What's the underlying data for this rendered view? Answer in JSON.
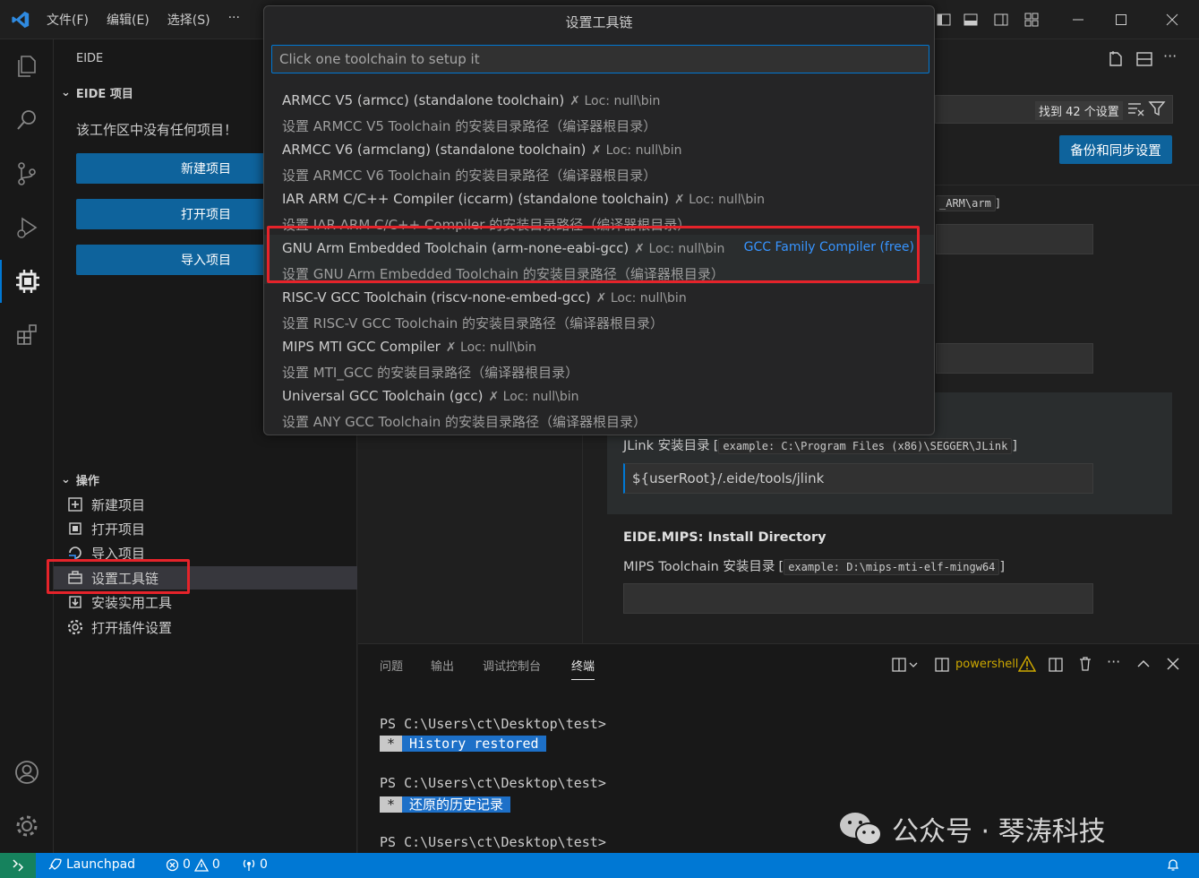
{
  "menu": {
    "file": "文件(F)",
    "edit": "编辑(E)",
    "select": "选择(S)",
    "more": "···"
  },
  "quick_pick": {
    "title": "设置工具链",
    "placeholder": "Click one toolchain to setup it",
    "items": [
      {
        "label": "ARMCC V5 (armcc) (standalone toolchain)",
        "loc": "✗ Loc: null\\bin",
        "detail": "设置 ARMCC V5 Toolchain 的安装目录路径（编译器根目录）",
        "desc": ""
      },
      {
        "label": "ARMCC V6 (armclang) (standalone toolchain)",
        "loc": "✗ Loc: null\\bin",
        "detail": "设置 ARMCC V6 Toolchain 的安装目录路径（编译器根目录）",
        "desc": ""
      },
      {
        "label": "IAR ARM C/C++ Compiler (iccarm) (standalone toolchain)",
        "loc": "✗ Loc: null\\bin",
        "detail": "设置 IAR ARM C/C++ Compiler 的安装目录路径（编译器根目录）",
        "desc": ""
      },
      {
        "label": "GNU Arm Embedded Toolchain (arm-none-eabi-gcc)",
        "loc": "✗ Loc: null\\bin",
        "detail": "设置 GNU Arm Embedded Toolchain 的安装目录路径（编译器根目录）",
        "desc": "GCC Family Compiler (free)"
      },
      {
        "label": "RISC-V GCC Toolchain (riscv-none-embed-gcc)",
        "loc": "✗ Loc: null\\bin",
        "detail": "设置 RISC-V GCC Toolchain 的安装目录路径（编译器根目录）",
        "desc": ""
      },
      {
        "label": "MIPS MTI GCC Compiler",
        "loc": "✗ Loc: null\\bin",
        "detail": "设置 MTI_GCC 的安装目录路径（编译器根目录）",
        "desc": ""
      },
      {
        "label": "Universal GCC Toolchain (gcc)",
        "loc": "✗ Loc: null\\bin",
        "detail": "设置 ANY GCC Toolchain 的安装目录路径（编译器根目录）",
        "desc": ""
      }
    ]
  },
  "sidebar": {
    "title": "EIDE",
    "section_project": "EIDE 项目",
    "empty_msg": "该工作区中没有任何项目！",
    "btn_new": "新建项目",
    "btn_open": "打开项目",
    "btn_import": "导入项目",
    "section_ops": "操作",
    "ops": [
      "新建项目",
      "打开项目",
      "导入项目",
      "设置工具链",
      "安装实用工具",
      "打开插件设置"
    ]
  },
  "settings": {
    "found": "找到 42 个设置",
    "sync_btn": "备份和同步设置",
    "arm_path_fragment": "_ARM\\arm",
    "jlink_desc": "JLink 安装目录",
    "jlink_example": "example: C:\\Program Files (x86)\\SEGGER\\JLink",
    "jlink_value": "${userRoot}/.eide/tools/jlink",
    "mips_title": "EIDE.MIPS: Install Directory",
    "mips_desc": "MIPS Toolchain 安装目录",
    "mips_example": "example: D:\\mips-mti-elf-mingw64"
  },
  "panel": {
    "tabs": [
      "问题",
      "输出",
      "调试控制台",
      "终端"
    ],
    "shell": "powershell",
    "lines": [
      "PS C:\\Users\\ct\\Desktop\\test>",
      "History restored",
      "PS C:\\Users\\ct\\Desktop\\test>",
      "还原的历史记录",
      "PS C:\\Users\\ct\\Desktop\\test>"
    ],
    "star": "*"
  },
  "statusbar": {
    "launchpad": "Launchpad",
    "errors": "0",
    "warnings": "0",
    "ports": "0"
  },
  "watermark": "公众号 · 琴涛科技",
  "colors": {
    "accent": "#0078d4",
    "highlight": "#e5232a",
    "link": "#3794ff"
  }
}
